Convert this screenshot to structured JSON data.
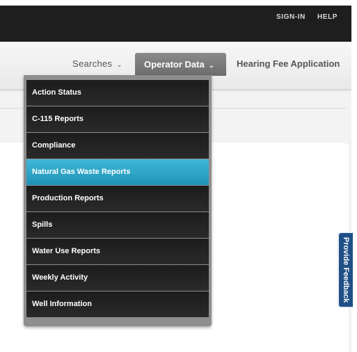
{
  "header": {
    "signin_label": "SIGN-IN",
    "help_label": "HELP"
  },
  "nav": {
    "searches_label": "Searches",
    "operator_label": "Operator Data",
    "hearing_label": "Hearing Fee Application",
    "chevron": "⌄"
  },
  "dropdown": {
    "items": [
      {
        "label": "Action Status"
      },
      {
        "label": "C-115 Reports"
      },
      {
        "label": "Compliance"
      },
      {
        "label": "Natural Gas Waste Reports",
        "active": true
      },
      {
        "label": "Production Reports"
      },
      {
        "label": "Spills"
      },
      {
        "label": "Water Use Reports"
      },
      {
        "label": "Weekly Activity"
      },
      {
        "label": "Well Information"
      }
    ]
  },
  "feedback": {
    "label": "Provide Feedback"
  },
  "colors": {
    "topbar": "#1e1e1e",
    "active_item": "#2aa6c8",
    "feedback_tab": "#1f4f86"
  }
}
